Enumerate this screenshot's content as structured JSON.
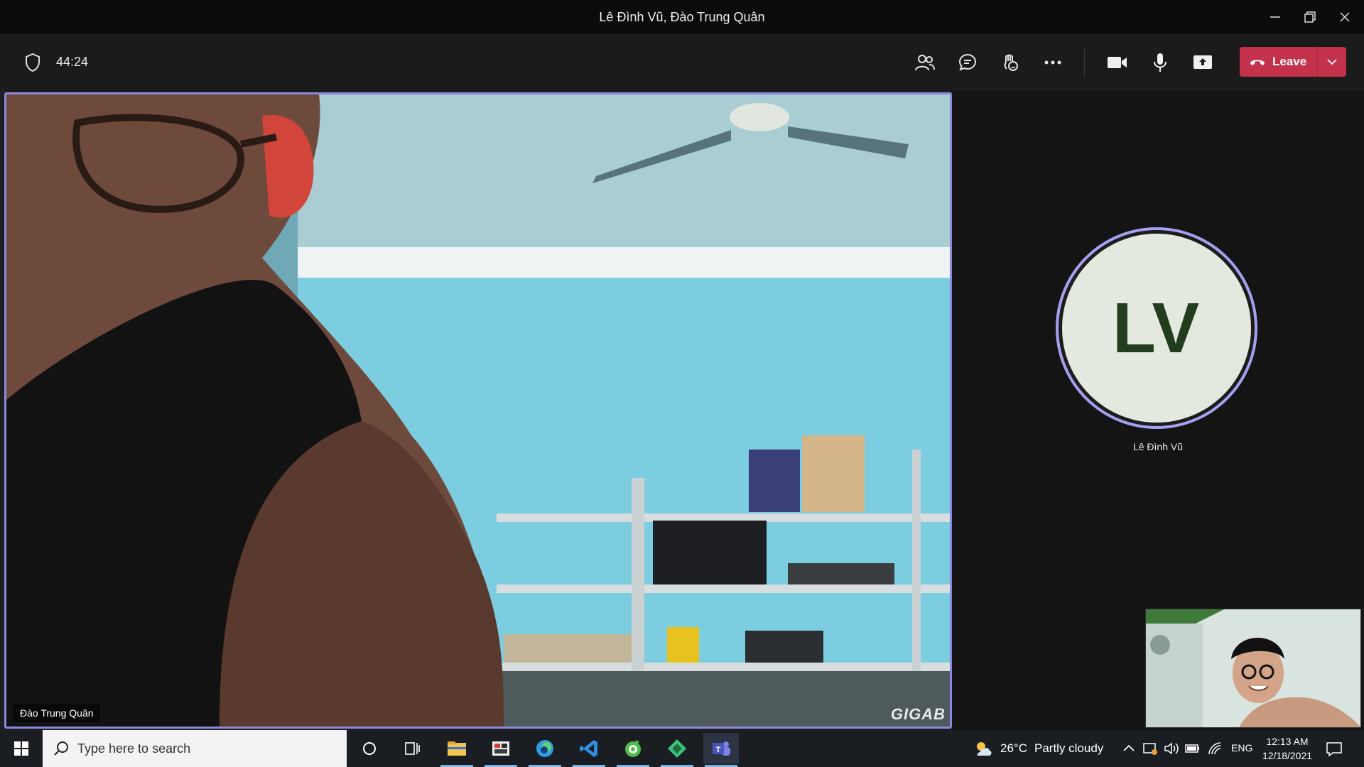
{
  "window": {
    "title": "Lê Đình Vũ, Đào Trung Quân"
  },
  "toolbar": {
    "timer": "44:24",
    "buttons": [
      "Show participants",
      "Show conversation",
      "Reactions",
      "More actions",
      "Camera",
      "Mic",
      "Share content"
    ],
    "leave_label": "Leave",
    "leave_color": "#c4314b"
  },
  "stage": {
    "main_participant": "Đào Trung Quân",
    "main_watermark": "GIGAB",
    "side_participant": {
      "initials": "LV",
      "name": "Lê Đình Vũ"
    },
    "accent_color": "#8b88dd"
  },
  "taskbar": {
    "search_placeholder": "Type here to search",
    "apps": [
      "cortana-icon",
      "task-view-icon",
      "file-explorer-icon",
      "photo-app-icon",
      "edge-icon",
      "vscode-icon",
      "app-green-icon",
      "app-diamond-icon",
      "teams-icon"
    ],
    "weather_temp": "26°C",
    "weather_text": "Partly cloudy",
    "language": "ENG",
    "time": "12:13 AM",
    "date": "12/18/2021"
  }
}
